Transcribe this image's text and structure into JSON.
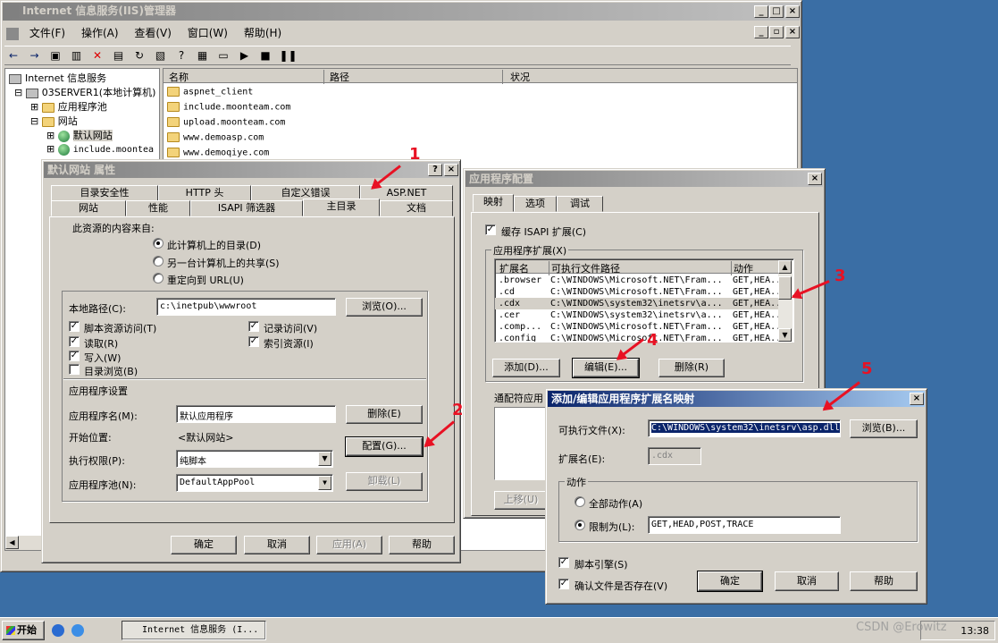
{
  "main_window": {
    "title": "Internet 信息服务(IIS)管理器",
    "menu": [
      "文件(F)",
      "操作(A)",
      "查看(V)",
      "窗口(W)",
      "帮助(H)"
    ]
  },
  "tree": {
    "root": "Internet 信息服务",
    "server": "03SERVER1(本地计算机)",
    "app_pools": "应用程序池",
    "websites": "网站",
    "default_site": "默认网站",
    "include_site": "include.moontea"
  },
  "list": {
    "headers": [
      "名称",
      "路径",
      "状况"
    ],
    "items": [
      "aspnet_client",
      "include.moonteam.com",
      "upload.moonteam.com",
      "www.demoasp.com",
      "www.demoqiye.com"
    ]
  },
  "props": {
    "title": "默认网站 属性",
    "tabs_back": [
      "目录安全性",
      "HTTP 头",
      "自定义错误",
      "ASP.NET"
    ],
    "tabs_front": [
      "网站",
      "性能",
      "ISAPI 筛选器",
      "主目录",
      "文档"
    ],
    "source_label": "此资源的内容来自:",
    "radio_local": "此计算机上的目录(D)",
    "radio_share": "另一台计算机上的共享(S)",
    "radio_redirect": "重定向到 URL(U)",
    "local_path_label": "本地路径(C):",
    "local_path": "c:\\inetpub\\wwwroot",
    "browse": "浏览(O)...",
    "cb_script": "脚本资源访问(T)",
    "cb_read": "读取(R)",
    "cb_write": "写入(W)",
    "cb_dirbrowse": "目录浏览(B)",
    "cb_log": "记录访问(V)",
    "cb_index": "索引资源(I)",
    "app_settings": "应用程序设置",
    "app_name_label": "应用程序名(M):",
    "app_name": "默认应用程序",
    "remove": "删除(E)",
    "start_label": "开始位置:",
    "start_value": "<默认网站>",
    "config": "配置(G)...",
    "exec_label": "执行权限(P):",
    "exec_value": "纯脚本",
    "pool_label": "应用程序池(N):",
    "pool_value": "DefaultAppPool",
    "unload": "卸载(L)",
    "ok": "确定",
    "cancel": "取消",
    "apply": "应用(A)",
    "help": "帮助"
  },
  "appcfg": {
    "title": "应用程序配置",
    "tabs": [
      "映射",
      "选项",
      "调试"
    ],
    "cache_isapi": "缓存 ISAPI 扩展(C)",
    "ext_group": "应用程序扩展(X)",
    "columns": [
      "扩展名",
      "可执行文件路径",
      "动作"
    ],
    "rows": [
      {
        "ext": ".browser",
        "path": "C:\\WINDOWS\\Microsoft.NET\\Fram...",
        "verb": "GET,HEA..."
      },
      {
        "ext": ".cd",
        "path": "C:\\WINDOWS\\Microsoft.NET\\Fram...",
        "verb": "GET,HEA..."
      },
      {
        "ext": ".cdx",
        "path": "C:\\WINDOWS\\system32\\inetsrv\\a...",
        "verb": "GET,HEA..."
      },
      {
        "ext": ".cer",
        "path": "C:\\WINDOWS\\system32\\inetsrv\\a...",
        "verb": "GET,HEA..."
      },
      {
        "ext": ".comp...",
        "path": "C:\\WINDOWS\\Microsoft.NET\\Fram...",
        "verb": "GET,HEA..."
      },
      {
        "ext": ".config",
        "path": "C:\\WINDOWS\\Microsoft.NET\\Fram...",
        "verb": "GET,HEA..."
      }
    ],
    "add": "添加(D)...",
    "edit": "编辑(E)...",
    "remove": "删除(R)",
    "wildcard": "通配符应用",
    "move_up": "上移(U)"
  },
  "mapdlg": {
    "title": "添加/编辑应用程序扩展名映射",
    "exe_label": "可执行文件(X):",
    "exe_value": "C:\\WINDOWS\\system32\\inetsrv\\asp.dll",
    "browse": "浏览(B)...",
    "ext_label": "扩展名(E):",
    "ext_value": ".cdx",
    "verbs_group": "动作",
    "all_verbs": "全部动作(A)",
    "limit_to": "限制为(L):",
    "limit_value": "GET,HEAD,POST,TRACE",
    "script_engine": "脚本引擎(S)",
    "verify_file": "确认文件是否存在(V)",
    "ok": "确定",
    "cancel": "取消",
    "help": "帮助"
  },
  "annotations": [
    "1",
    "2",
    "3",
    "4",
    "5"
  ],
  "taskbar": {
    "start": "开始",
    "task": "Internet 信息服务 (I...",
    "clock": "13:38",
    "watermark": "CSDN @Erowitz"
  }
}
